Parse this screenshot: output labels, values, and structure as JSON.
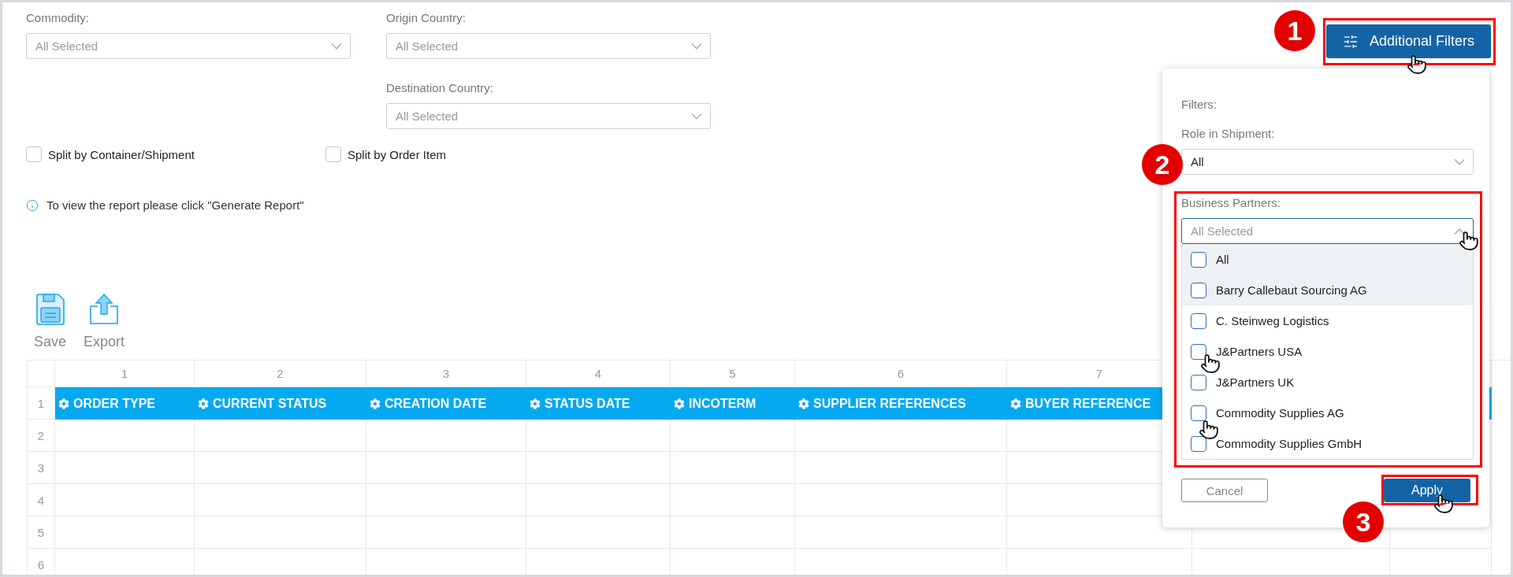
{
  "filters": [
    {
      "label": "Commodity:",
      "value": "All Selected"
    },
    {
      "label": "Origin Country:",
      "value": "All Selected"
    },
    {
      "label": "Destination Country:",
      "value": "All Selected"
    }
  ],
  "options": [
    {
      "label": "Split by Container/Shipment",
      "checked": false
    },
    {
      "label": "Split by Order Item",
      "checked": false
    }
  ],
  "info": "To view the report please click \"Generate Report\"",
  "toolbar": [
    {
      "kind": "save",
      "label": "Save"
    },
    {
      "kind": "export",
      "label": "Export"
    }
  ],
  "grid": {
    "column_numbers": [
      "1",
      "2",
      "3",
      "4",
      "5",
      "6",
      "7"
    ],
    "headers": [
      "ORDER TYPE",
      "CURRENT STATUS",
      "CREATION DATE",
      "STATUS DATE",
      "INCOTERM",
      "SUPPLIER REFERENCES",
      "BUYER REFERENCE"
    ],
    "row_numbers": [
      "1",
      "2",
      "3",
      "4",
      "5",
      "6"
    ]
  },
  "additional_filters_button": "Additional Filters",
  "popup": {
    "title": "Filters:",
    "role_label": "Role in Shipment:",
    "role_value": "All",
    "partners_label": "Business Partners:",
    "partners_placeholder": "All Selected",
    "partners": [
      {
        "label": "All",
        "checked": false,
        "highlighted": true
      },
      {
        "label": "Barry Callebaut Sourcing AG",
        "checked": false,
        "highlighted": true
      },
      {
        "label": "C. Steinweg Logistics",
        "checked": false,
        "highlighted": false
      },
      {
        "label": "J&Partners USA",
        "checked": false,
        "highlighted": false
      },
      {
        "label": "J&Partners UK",
        "checked": false,
        "highlighted": false
      },
      {
        "label": "Commodity Supplies AG",
        "checked": false,
        "highlighted": false
      },
      {
        "label": "Commodity Supplies GmbH",
        "checked": false,
        "highlighted": false
      }
    ],
    "cancel": "Cancel",
    "apply": "Apply"
  },
  "steps": [
    "1",
    "2",
    "3"
  ]
}
